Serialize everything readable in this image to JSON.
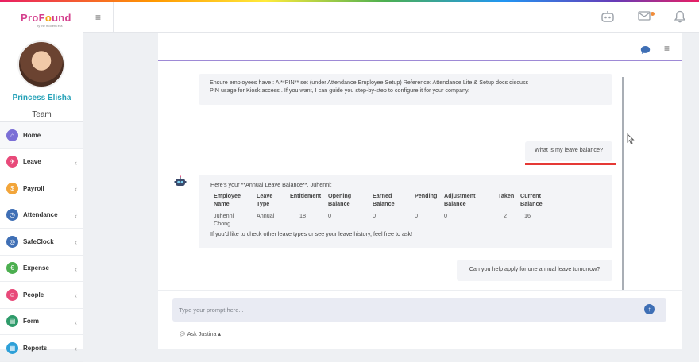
{
  "brand": {
    "logo_main": "ProF",
    "logo_o": "o",
    "logo_rest": "und",
    "logo_sub": "by the modern era"
  },
  "user": {
    "name": "Princess Elisha",
    "team": "Team"
  },
  "nav": [
    {
      "label": "Home",
      "icon": "home-icon",
      "color": "#7b6fd6"
    },
    {
      "label": "Leave",
      "icon": "leave-icon",
      "color": "#e84a7a"
    },
    {
      "label": "Payroll",
      "icon": "payroll-icon",
      "color": "#f2a53a"
    },
    {
      "label": "Attendance",
      "icon": "attendance-icon",
      "color": "#3f6fb5"
    },
    {
      "label": "SafeClock",
      "icon": "safeclock-icon",
      "color": "#3f6fb5"
    },
    {
      "label": "Expense",
      "icon": "expense-icon",
      "color": "#4caf50"
    },
    {
      "label": "People",
      "icon": "people-icon",
      "color": "#e84a7a"
    },
    {
      "label": "Form",
      "icon": "form-icon",
      "color": "#2e9b6a"
    },
    {
      "label": "Reports",
      "icon": "reports-icon",
      "color": "#2ea0d8"
    }
  ],
  "chat": {
    "message_1_line_1": "Ensure employees have : A **PIN** set (under Attendance Employee Setup) Reference: Attendance Lite & Setup docs discuss",
    "message_1_line_2": "PIN usage for Kiosk access . If you want, I can guide you step-by-step to configure it for your company.",
    "user_question_1": "What is my leave balance?",
    "balance_intro": "Here's your **Annual Leave Balance**, Juhenni:",
    "balance_table": {
      "headers": [
        "Employee Name",
        "Leave Type",
        "Entitlement",
        "Opening Balance",
        "Earned Balance",
        "Pending",
        "Adjustment Balance",
        "Taken",
        "Current Balance"
      ],
      "row": [
        "Juhenni Chong",
        "Annual",
        "18",
        "0",
        "0",
        "0",
        "0",
        "2",
        "16"
      ]
    },
    "balance_footer": "If you'd like to check other leave types or see your leave history, feel free to ask!",
    "user_question_2": "Can you help apply for one annual leave tomorrow?"
  },
  "input": {
    "placeholder": "Type your prompt here...",
    "ask_label": "Ask Justina"
  }
}
